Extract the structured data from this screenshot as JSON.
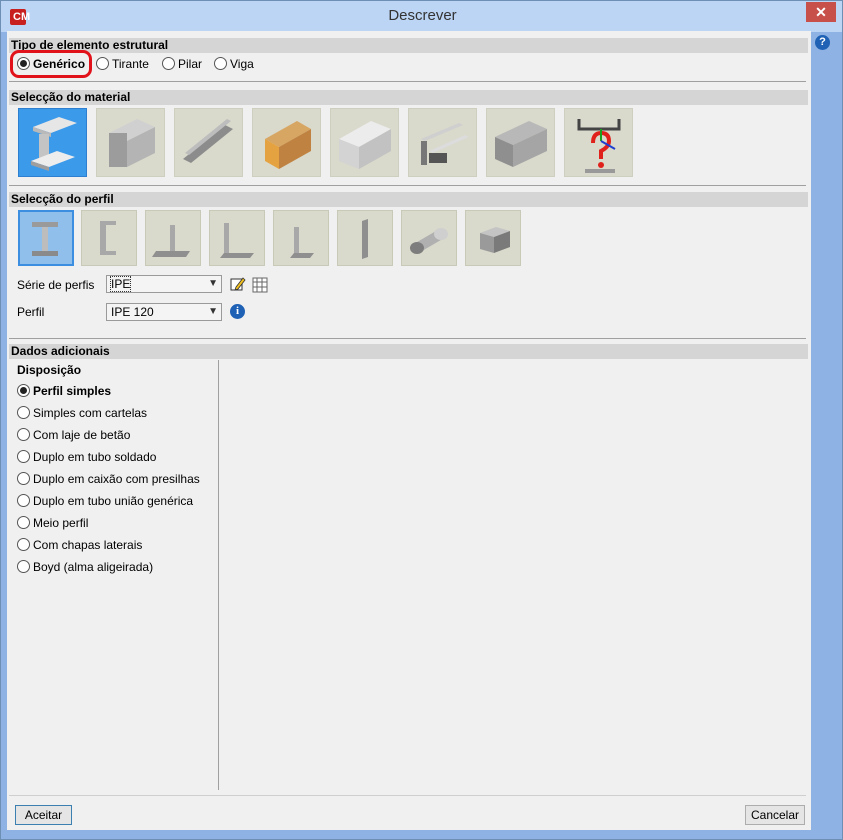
{
  "window": {
    "title": "Descrever",
    "close_label": "✕",
    "help_label": "?"
  },
  "tipo": {
    "header": "Tipo de elemento estrutural",
    "options": [
      {
        "label": "Genérico",
        "checked": true
      },
      {
        "label": "Tirante",
        "checked": false
      },
      {
        "label": "Pilar",
        "checked": false
      },
      {
        "label": "Viga",
        "checked": false
      }
    ]
  },
  "material": {
    "header": "Selecção do material",
    "tiles": [
      {
        "name": "steel-rolled-icon",
        "selected": true
      },
      {
        "name": "steel-welded-icon",
        "selected": false
      },
      {
        "name": "steel-cold-formed-icon",
        "selected": false
      },
      {
        "name": "timber-icon",
        "selected": false
      },
      {
        "name": "aluminium-icon",
        "selected": false
      },
      {
        "name": "generic-sections-icon",
        "selected": false
      },
      {
        "name": "concrete-icon",
        "selected": false
      },
      {
        "name": "user-defined-section-icon",
        "selected": false
      }
    ]
  },
  "perfil": {
    "header": "Selecção do perfil",
    "tiles": [
      {
        "name": "i-section-icon",
        "selected": true
      },
      {
        "name": "channel-section-icon",
        "selected": false
      },
      {
        "name": "t-section-icon",
        "selected": false
      },
      {
        "name": "equal-angle-icon",
        "selected": false
      },
      {
        "name": "unequal-angle-icon",
        "selected": false
      },
      {
        "name": "flat-plate-icon",
        "selected": false
      },
      {
        "name": "round-bar-icon",
        "selected": false
      },
      {
        "name": "square-bar-icon",
        "selected": false
      }
    ],
    "serie_label": "Série de perfis",
    "serie_value": "IPE",
    "perfil_label": "Perfil",
    "perfil_value": "IPE 120",
    "info_label": "i"
  },
  "dados": {
    "header": "Dados adicionais",
    "disposicao_label": "Disposição",
    "options": [
      {
        "label": "Perfil simples",
        "checked": true
      },
      {
        "label": "Simples com cartelas",
        "checked": false
      },
      {
        "label": "Com laje de betão",
        "checked": false
      },
      {
        "label": "Duplo em tubo soldado",
        "checked": false
      },
      {
        "label": "Duplo em caixão com presilhas",
        "checked": false
      },
      {
        "label": "Duplo em tubo união genérica",
        "checked": false
      },
      {
        "label": "Meio perfil",
        "checked": false
      },
      {
        "label": "Com chapas laterais",
        "checked": false
      },
      {
        "label": "Boyd (alma aligeirada)",
        "checked": false
      }
    ]
  },
  "footer": {
    "accept_label": "Aceitar",
    "cancel_label": "Cancelar"
  }
}
